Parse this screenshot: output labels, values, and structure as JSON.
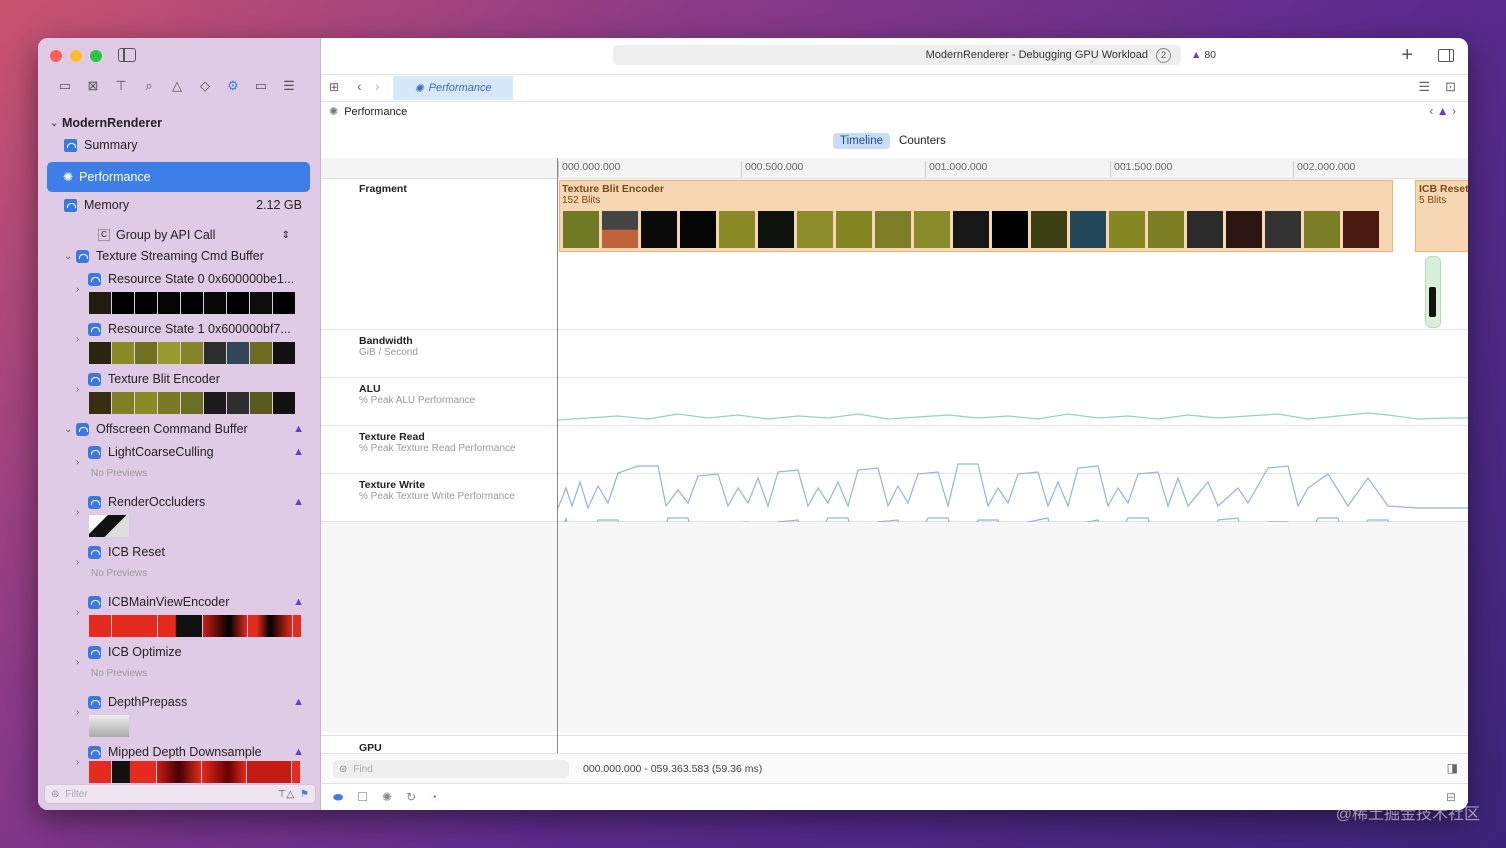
{
  "window": {
    "title": "ModernRenderer - Debugging GPU Workload",
    "title_badge": "2",
    "warning_count": "80"
  },
  "colors": {
    "accent": "#3d7ee8",
    "sidebar_bg": "#e0cbe6",
    "warning": "#6b3fc4"
  },
  "sidebar": {
    "root": "ModernRenderer",
    "summary": "Summary",
    "performance": "Performance",
    "memory": "Memory",
    "memory_value": "2.12 GB",
    "group_by": "Group by API Call",
    "filter_placeholder": "Filter",
    "items": [
      {
        "label": "Texture Streaming Cmd Buffer"
      },
      {
        "label": "Resource State 0 0x600000be1..."
      },
      {
        "label": "Resource State 1 0x600000bf7..."
      },
      {
        "label": "Texture Blit Encoder"
      },
      {
        "label": "Offscreen Command Buffer"
      },
      {
        "label": "LightCoarseCulling"
      },
      {
        "label": "RenderOccluders"
      },
      {
        "label": "ICB Reset"
      },
      {
        "label": "ICBMainViewEncoder"
      },
      {
        "label": "ICB Optimize"
      },
      {
        "label": "DepthPrepass"
      },
      {
        "label": "Mipped Depth Downsample"
      }
    ],
    "no_previews": "No Previews"
  },
  "tabbar": {
    "tab_label": "Performance"
  },
  "breadcrumb": {
    "label": "Performance"
  },
  "segmented": {
    "timeline": "Timeline",
    "counters": "Counters"
  },
  "ruler": {
    "ticks": [
      "000.000.000",
      "000.500.000",
      "001.000.000",
      "001.500.000",
      "002.000.000"
    ]
  },
  "tracks": {
    "fragment": "Fragment",
    "bandwidth": "Bandwidth",
    "bandwidth_sub": "GiB / Second",
    "alu": "ALU",
    "alu_sub": "% Peak ALU Performance",
    "texture_read": "Texture Read",
    "texture_read_sub": "% Peak Texture Read Performance",
    "texture_write": "Texture Write",
    "texture_write_sub": "% Peak Texture Write Performance",
    "gpu": "GPU"
  },
  "encoders": {
    "blit_title": "Texture Blit Encoder",
    "blit_sub": "152 Blits",
    "icb_title": "ICB Reset",
    "icb_sub": "5 Blits"
  },
  "status": {
    "find_placeholder": "Find",
    "range": "000.000.000 - 059.363.583 (59.36 ms)"
  },
  "watermark": "@稀土掘金技术社区"
}
